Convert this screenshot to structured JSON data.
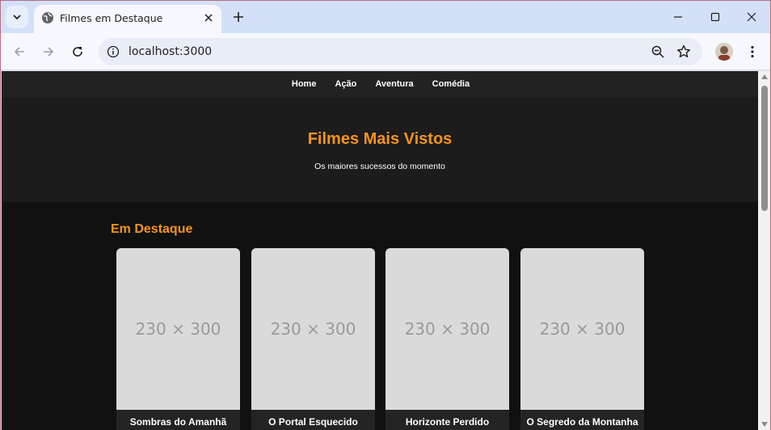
{
  "browser": {
    "tab_title": "Filmes em Destaque",
    "url": "localhost:3000",
    "icons": [
      "tab-search-icon",
      "globe-icon",
      "close-icon",
      "plus-icon",
      "minimize-icon",
      "maximize-icon",
      "window-close-icon",
      "back-icon",
      "forward-icon",
      "reload-icon",
      "info-icon",
      "zoom-icon",
      "star-icon",
      "avatar",
      "kebab-menu-icon"
    ]
  },
  "nav": {
    "items": [
      {
        "label": "Home"
      },
      {
        "label": "Ação"
      },
      {
        "label": "Aventura"
      },
      {
        "label": "Comédia"
      }
    ]
  },
  "hero": {
    "title": "Filmes Mais Vistos",
    "subtitle": "Os maiores sucessos do momento"
  },
  "featured": {
    "heading": "Em Destaque",
    "movies": [
      {
        "poster": "230 × 300",
        "title": "Sombras do Amanhã"
      },
      {
        "poster": "230 × 300",
        "title": "O Portal Esquecido"
      },
      {
        "poster": "230 × 300",
        "title": "Horizonte Perdido"
      },
      {
        "poster": "230 × 300",
        "title": "O Segredo da Montanha"
      }
    ]
  },
  "colors": {
    "accent": "#f5941d",
    "page_bg": "#111111",
    "nav_bg": "#222222"
  }
}
